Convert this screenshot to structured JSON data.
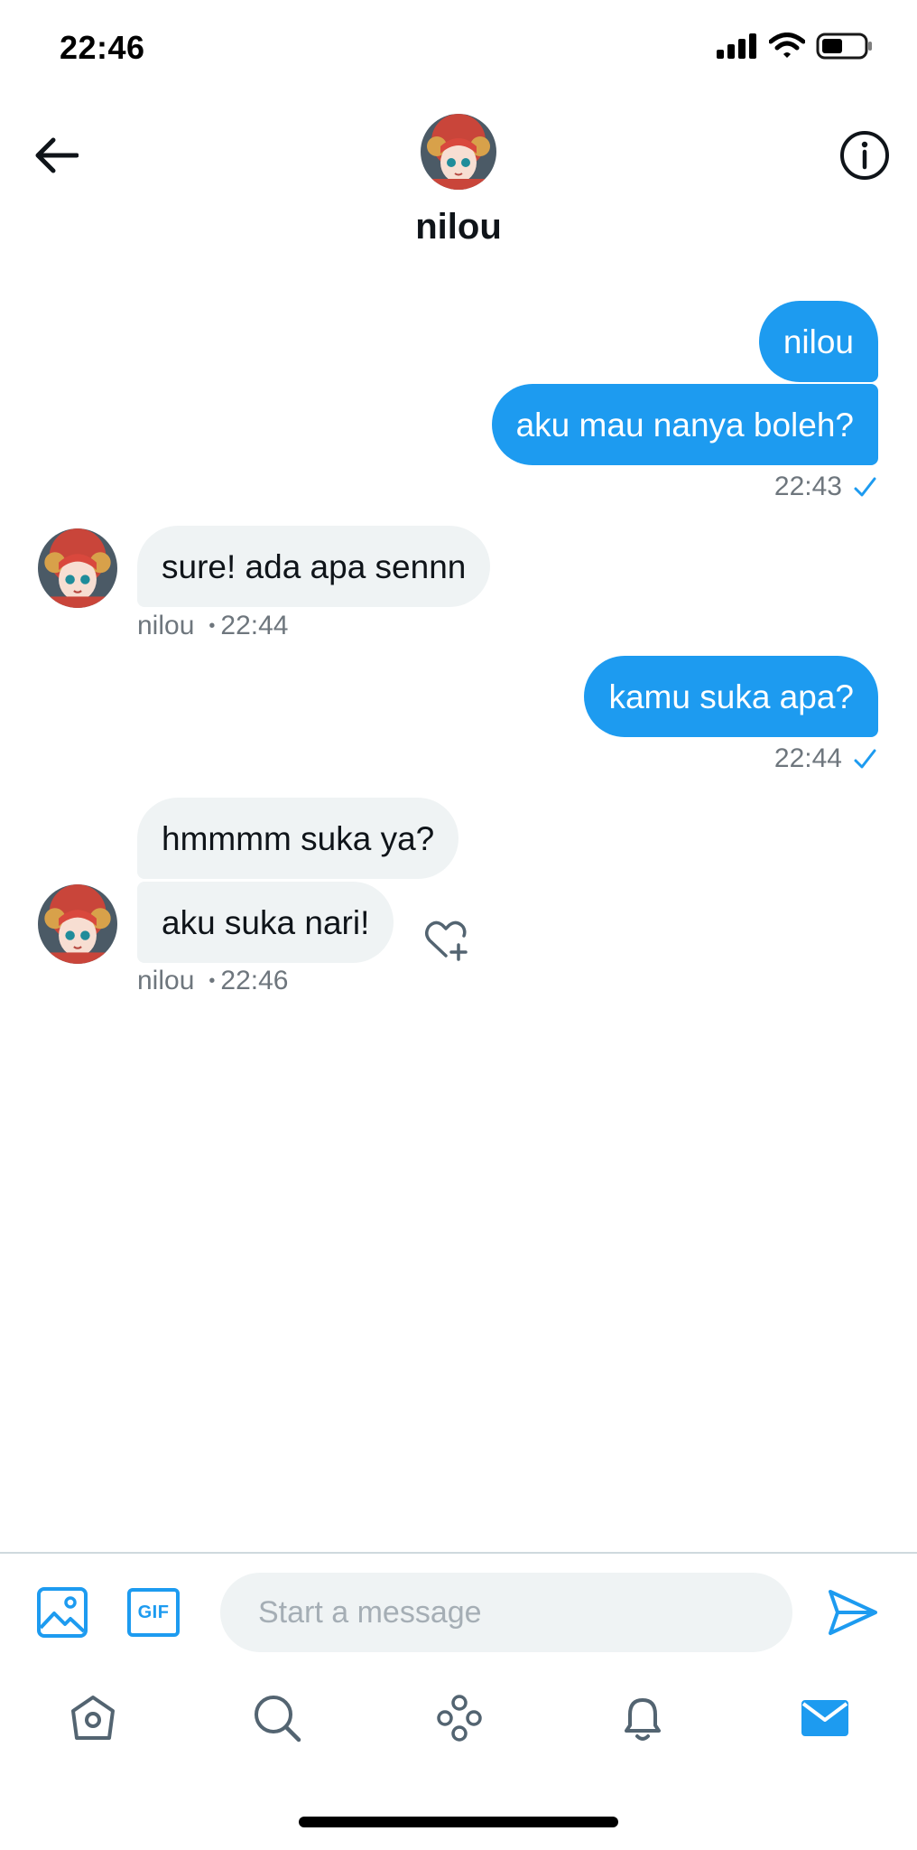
{
  "status_bar": {
    "time": "22:46"
  },
  "header": {
    "name": "nilou"
  },
  "messages": [
    {
      "text": "nilou",
      "dir": "out"
    },
    {
      "text": "aku mau nanya boleh?",
      "dir": "out"
    },
    {
      "text": "sure! ada apa sennn",
      "dir": "in"
    },
    {
      "text": "kamu suka apa?",
      "dir": "out"
    },
    {
      "text": "hmmmm suka ya?",
      "dir": "in"
    },
    {
      "text": "aku suka nari!",
      "dir": "in"
    }
  ],
  "meta": {
    "out_1_time": "22:43",
    "in_1_sender": "nilou",
    "in_1_time": "22:44",
    "out_2_time": "22:44",
    "in_2_sender": "nilou",
    "in_2_time": "22:46"
  },
  "composer": {
    "placeholder": "Start a message",
    "gif_label": "GIF"
  },
  "colors": {
    "accent": "#1d9bf0",
    "incoming_bubble": "#eff3f4",
    "meta_text": "#6e767d"
  },
  "icons": {
    "back": "arrow-left-icon",
    "info": "info-icon",
    "image": "image-icon",
    "gif": "gif-icon",
    "send": "send-icon",
    "react": "heart-plus-icon",
    "nav": [
      "home-icon",
      "search-icon",
      "spaces-icon",
      "bell-icon",
      "mail-icon"
    ]
  }
}
